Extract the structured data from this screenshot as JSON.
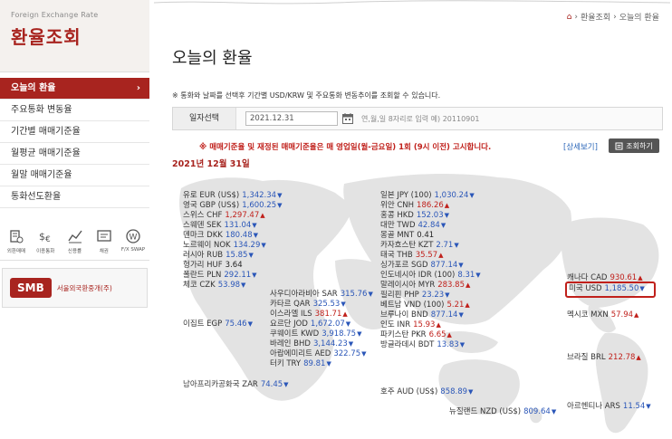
{
  "sidebar": {
    "eng_title": "Foreign Exchange Rate",
    "title": "환율조회",
    "items": [
      {
        "label": "오늘의 환율",
        "active": true
      },
      {
        "label": "주요통화 변동율",
        "active": false
      },
      {
        "label": "기간별 매매기준율",
        "active": false
      },
      {
        "label": "월평균 매매기준율",
        "active": false
      },
      {
        "label": "월말 매매기준율",
        "active": false
      },
      {
        "label": "통화선도환율",
        "active": false
      }
    ],
    "active_arrow": "›",
    "quick_icons": [
      {
        "label": "외환매매",
        "icon": "coin-stack-icon"
      },
      {
        "label": "이종통화",
        "icon": "currency-swap-icon"
      },
      {
        "label": "신용률",
        "icon": "line-chart-icon"
      },
      {
        "label": "채권",
        "icon": "bond-icon"
      },
      {
        "label": "F/X SWAP",
        "icon": "won-circle-icon"
      }
    ],
    "smb_logo": "SMB",
    "smb_name": "서울외국환중개(주)"
  },
  "breadcrumb": [
    "환율조회",
    "오늘의 환율"
  ],
  "page_title": "오늘의 환율",
  "info": "※ 통화와 날짜를 선택후 기간별 USD/KRW 및 주요통화 변동추이를 조회할 수 있습니다.",
  "date_search": {
    "label": "일자선택",
    "value": "2021.12.31",
    "hint": "연,월,일 8자리로 입력 예) 20110901"
  },
  "notice": "※ 매매기준율 및 재정된 매매기준율은 매 영업일(월-금요일) 1회 (9시 이전) 고시합니다.",
  "detail_link": "[상세보기]",
  "query_button": "조회하기",
  "date_label": "2021년 12월 31일",
  "colors": {
    "accent": "#a8241f",
    "down": "#2a56b8",
    "up": "#c0201b"
  },
  "rates": [
    {
      "name": "유로 EUR (US$)",
      "value": "1,342.34",
      "dir": "down"
    },
    {
      "name": "영국 GBP (US$)",
      "value": "1,600.25",
      "dir": "down"
    },
    {
      "name": "스위스 CHF",
      "value": "1,297.47",
      "dir": "up"
    },
    {
      "name": "스웨덴 SEK",
      "value": "131.04",
      "dir": "down"
    },
    {
      "name": "덴마크 DKK",
      "value": "180.48",
      "dir": "down"
    },
    {
      "name": "노르웨이 NOK",
      "value": "134.29",
      "dir": "down"
    },
    {
      "name": "러시아 RUB",
      "value": "15.85",
      "dir": "down"
    },
    {
      "name": "헝가리 HUF",
      "value": "3.64",
      "dir": "flat"
    },
    {
      "name": "폴란드 PLN",
      "value": "292.11",
      "dir": "down"
    },
    {
      "name": "체코 CZK",
      "value": "53.98",
      "dir": "down"
    },
    {
      "name": "이집트 EGP",
      "value": "75.46",
      "dir": "down"
    },
    {
      "name": "남아프리카공화국 ZAR",
      "value": "74.45",
      "dir": "down"
    },
    {
      "name": "사우디아라비아 SAR",
      "value": "315.76",
      "dir": "down"
    },
    {
      "name": "카타르 QAR",
      "value": "325.53",
      "dir": "down"
    },
    {
      "name": "이스라엘 ILS",
      "value": "381.71",
      "dir": "up"
    },
    {
      "name": "요르단 JOD",
      "value": "1,672.07",
      "dir": "down"
    },
    {
      "name": "쿠웨이트 KWD",
      "value": "3,918.75",
      "dir": "down"
    },
    {
      "name": "바레인 BHD",
      "value": "3,144.23",
      "dir": "down"
    },
    {
      "name": "아랍에미리트 AED",
      "value": "322.75",
      "dir": "down"
    },
    {
      "name": "터키 TRY",
      "value": "89.81",
      "dir": "down"
    },
    {
      "name": "일본 JPY (100)",
      "value": "1,030.24",
      "dir": "down"
    },
    {
      "name": "위안 CNH",
      "value": "186.26",
      "dir": "up"
    },
    {
      "name": "홍콩 HKD",
      "value": "152.03",
      "dir": "down"
    },
    {
      "name": "대만 TWD",
      "value": "42.84",
      "dir": "down"
    },
    {
      "name": "몽골 MNT",
      "value": "0.41",
      "dir": "flat"
    },
    {
      "name": "카자흐스탄 KZT",
      "value": "2.71",
      "dir": "down"
    },
    {
      "name": "태국 THB",
      "value": "35.57",
      "dir": "up"
    },
    {
      "name": "싱가포르 SGD",
      "value": "877.14",
      "dir": "down"
    },
    {
      "name": "인도네시아 IDR (100)",
      "value": "8.31",
      "dir": "down"
    },
    {
      "name": "말레이시아 MYR",
      "value": "283.85",
      "dir": "up"
    },
    {
      "name": "필리핀 PHP",
      "value": "23.23",
      "dir": "down"
    },
    {
      "name": "베트남 VND (100)",
      "value": "5.21",
      "dir": "up"
    },
    {
      "name": "브루나이 BND",
      "value": "877.14",
      "dir": "down"
    },
    {
      "name": "인도 INR",
      "value": "15.93",
      "dir": "up"
    },
    {
      "name": "파키스탄 PKR",
      "value": "6.65",
      "dir": "up"
    },
    {
      "name": "방글라데시 BDT",
      "value": "13.83",
      "dir": "down"
    },
    {
      "name": "호주 AUD (US$)",
      "value": "858.89",
      "dir": "down"
    },
    {
      "name": "뉴질랜드 NZD (US$)",
      "value": "809.64",
      "dir": "down"
    },
    {
      "name": "캐나다 CAD",
      "value": "930.61",
      "dir": "up"
    },
    {
      "name": "미국 USD",
      "value": "1,185.50",
      "dir": "down"
    },
    {
      "name": "멕시코 MXN",
      "value": "57.94",
      "dir": "up"
    },
    {
      "name": "브라질 BRL",
      "value": "212.78",
      "dir": "up"
    },
    {
      "name": "아르헨티나 ARS",
      "value": "11.54",
      "dir": "down"
    }
  ]
}
